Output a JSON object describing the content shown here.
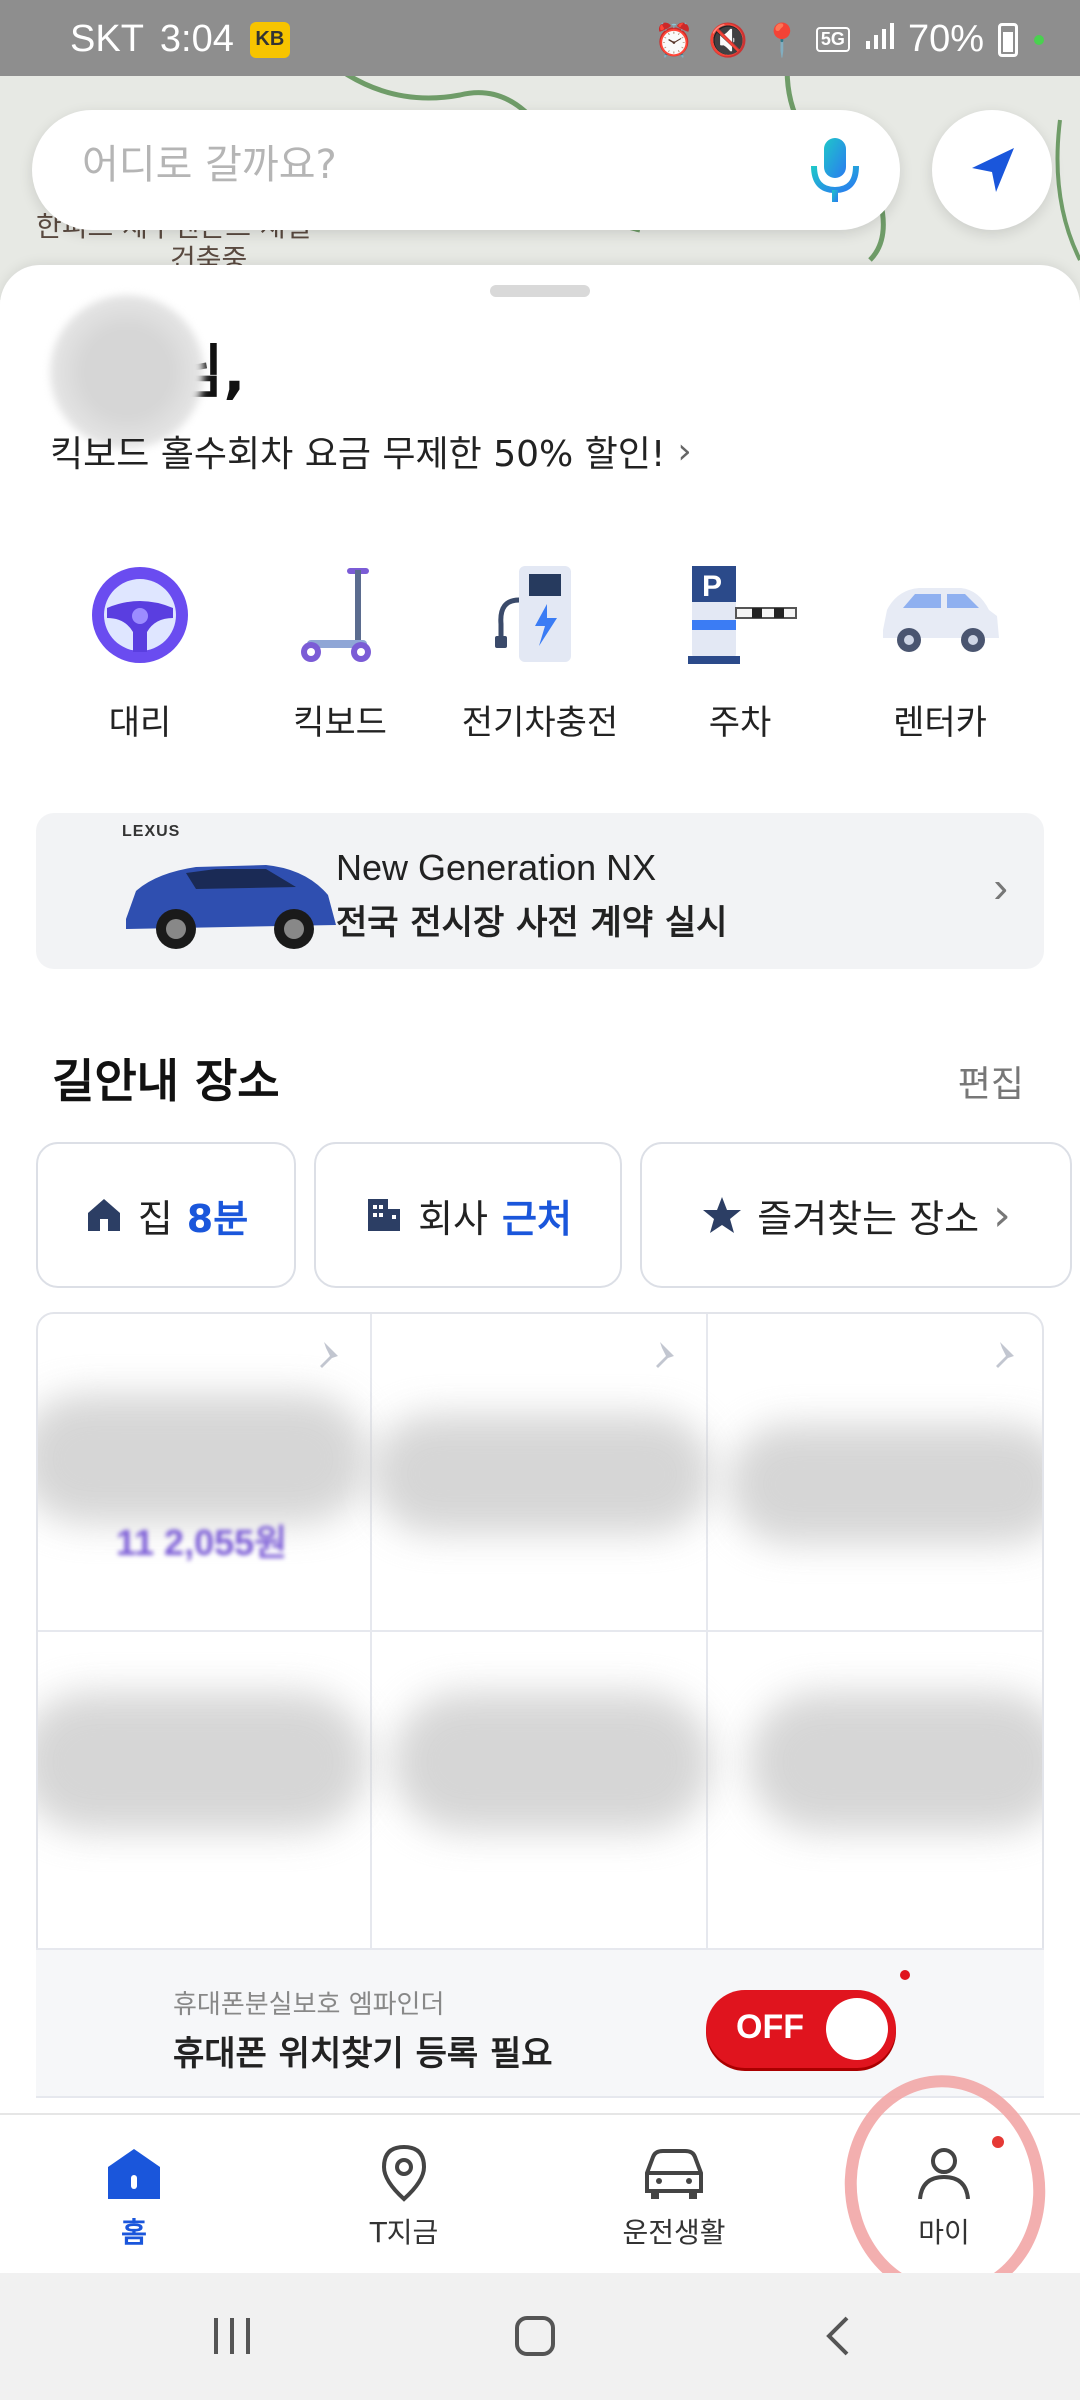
{
  "status_bar": {
    "carrier": "SKT",
    "time": "3:04",
    "badge_text": "KB",
    "network": "5G",
    "battery": "70%"
  },
  "map": {
    "label_1": "한피스 체구엔본트 새일",
    "label_2": "건축중"
  },
  "search": {
    "placeholder": "어디로 갈까요?"
  },
  "greeting": {
    "suffix": "님,",
    "promo": "킥보드 홀수회차 요금 무제한 50% 할인!"
  },
  "services": [
    {
      "label": "대리",
      "icon": "steering-wheel-icon"
    },
    {
      "label": "킥보드",
      "icon": "kickboard-icon"
    },
    {
      "label": "전기차충전",
      "icon": "ev-charger-icon"
    },
    {
      "label": "주차",
      "icon": "parking-gate-icon"
    },
    {
      "label": "렌터카",
      "icon": "rental-car-icon"
    }
  ],
  "ad": {
    "brand": "LEXUS",
    "title": "New Generation NX",
    "subtitle": "전국 전시장 사전 계약 실시"
  },
  "places": {
    "title": "길안내 장소",
    "edit": "편집",
    "home_label": "집",
    "home_time": "8분",
    "office_label": "회사",
    "office_status": "근처",
    "favorites_label": "즐겨찾는 장소",
    "price": "11 2,055원"
  },
  "notice": {
    "sub": "휴대폰분실보호 엠파인더",
    "main": "휴대폰 위치찾기 등록 필요",
    "toggle": "OFF"
  },
  "bottom_nav": {
    "home": "홈",
    "t_now": "T지금",
    "driving": "운전생활",
    "my": "마이"
  },
  "colors": {
    "accent": "#1a56db",
    "toggle_off": "#e0141e"
  }
}
